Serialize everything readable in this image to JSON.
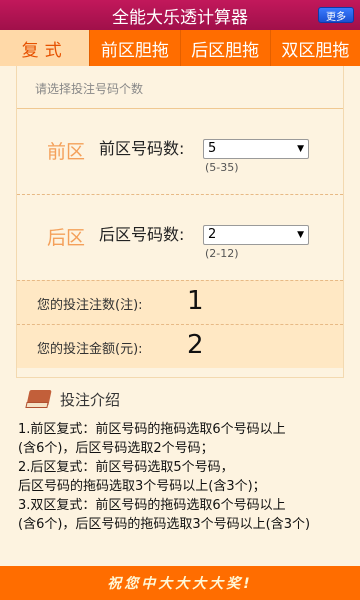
{
  "app": {
    "title": "全能大乐透计算器",
    "more_label": "更多"
  },
  "tabs": [
    {
      "label": "复式"
    },
    {
      "label": "前区胆拖"
    },
    {
      "label": "后区胆拖"
    },
    {
      "label": "双区胆拖"
    }
  ],
  "form": {
    "prompt": "请选择投注号码个数",
    "front": {
      "zone": "前区",
      "label": "前区号码数:",
      "value": "5",
      "range": "(5-35)"
    },
    "back": {
      "zone": "后区",
      "label": "后区号码数:",
      "value": "2",
      "range": "(2-12)"
    }
  },
  "results": {
    "count_label": "您的投注注数(注):",
    "count_value": "1",
    "amount_label": "您的投注金额(元):",
    "amount_value": "2"
  },
  "intro": {
    "title": "投注介绍",
    "lines": [
      "1.前区复式：前区号码的拖码选取6个号码以上",
      "(含6个)，后区号码选取2个号码；",
      "2.后区复式：前区号码选取5个号码，",
      "后区号码的拖码选取3个号码以上(含3个)；",
      "3.双区复式：前区号码的拖码选取6个号码以上",
      "(含6个)，后区号码的拖码选取3个号码以上(含3个)"
    ]
  },
  "banner": {
    "text": "祝您中大大大大奖!"
  },
  "colors": {
    "titlebar": "#c2185b",
    "accent": "#ff6d00",
    "active_tab": "#ffd9a8",
    "panel": "#fdf3e0"
  }
}
